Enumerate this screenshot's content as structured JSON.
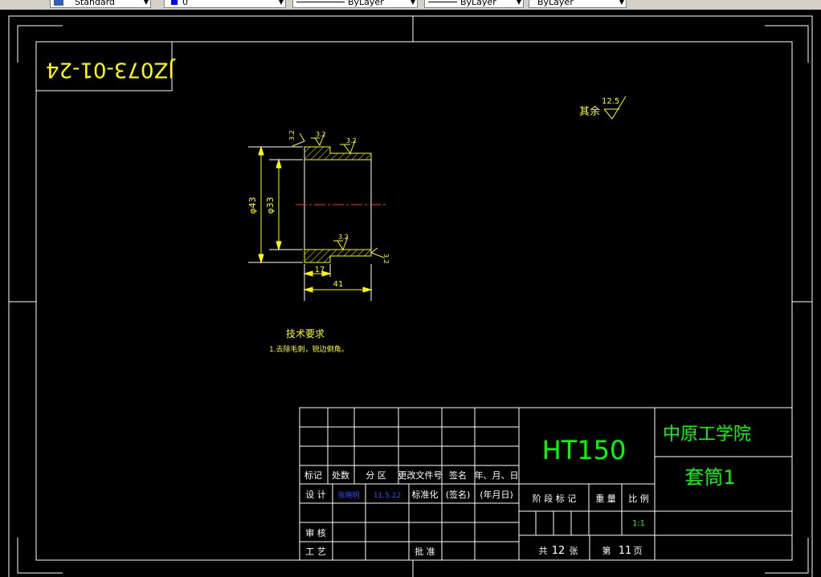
{
  "toolbar": {
    "text_style": "Standard",
    "layer": "0",
    "color": "ByLayer",
    "linetype": "ByLayer",
    "lineweight": "ByLayer"
  },
  "drawing": {
    "stamp_rotated": "JZ073-01-24",
    "roughness_other_label": "其余",
    "roughness_other_value": "12.5",
    "roughness_value": "3.2",
    "dim_outer_diameter": "φ43",
    "dim_inner_diameter": "φ33",
    "dim_step_length": "17",
    "dim_total_length": "41",
    "tech_req_title": "技术要求",
    "tech_req_item": "1.去除毛刺，锐边倒角。"
  },
  "title_block": {
    "material": "HT150",
    "school": "中原工学院",
    "part_name": "套筒1",
    "rev_headers": [
      "标记",
      "处数",
      "分 区",
      "更改文件号",
      "签名",
      "年、月、日"
    ],
    "design_label": "设 计",
    "designer": "张晓明",
    "design_date": "11.5.22",
    "standardize_label": "标准化",
    "sign_label": "(签名)",
    "date_label": "(年月日)",
    "stage_label": "阶 段 标 记",
    "weight_label": "重 量",
    "scale_label": "比 例",
    "scale_value": "1:1",
    "review_label": "审 核",
    "process_label": "工 艺",
    "approve_label": "批 准",
    "total_label": "共",
    "total_sheets": "12",
    "sheets_unit": "张",
    "page_label": "第",
    "page_number": "11",
    "page_unit": "页"
  }
}
